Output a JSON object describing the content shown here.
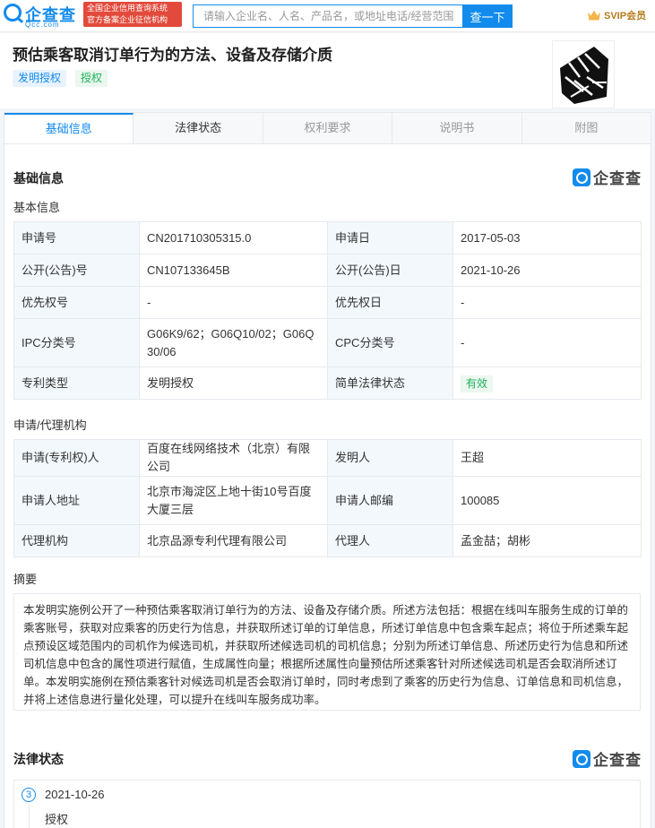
{
  "header": {
    "logo_name": "企查查",
    "logo_domain": "Qcc.com",
    "slogan_line1": "全国企业信用查询系统",
    "slogan_line2": "官方备案企业征信机构",
    "search_placeholder": "请输入企业名、人名、产品名，或地址电话/经营范围",
    "search_button": "查一下",
    "svip_label": "SVIP会员"
  },
  "patent": {
    "title": "预估乘客取消订单行为的方法、设备及存储介质",
    "tags": [
      "发明授权",
      "授权"
    ]
  },
  "tabs": [
    {
      "label": "基础信息",
      "state": "active"
    },
    {
      "label": "法律状态",
      "state": "normal"
    },
    {
      "label": "权利要求",
      "state": "muted"
    },
    {
      "label": "说明书",
      "state": "muted"
    },
    {
      "label": "附图",
      "state": "muted"
    }
  ],
  "basic": {
    "section_title": "基础信息",
    "watermark": "企查查",
    "subsection": "基本信息",
    "rows": [
      {
        "l1": "申请号",
        "v1": "CN201710305315.0",
        "l2": "申请日",
        "v2": "2017-05-03"
      },
      {
        "l1": "公开(公告)号",
        "v1": "CN107133645B",
        "l2": "公开(公告)日",
        "v2": "2021-10-26"
      },
      {
        "l1": "优先权号",
        "v1": "-",
        "l2": "优先权日",
        "v2": "-"
      },
      {
        "l1": "IPC分类号",
        "v1": "G06K9/62；G06Q10/02；G06Q30/06",
        "l2": "CPC分类号",
        "v2": "-"
      },
      {
        "l1": "专利类型",
        "v1": "发明授权",
        "l2": "简单法律状态",
        "v2": "有效"
      }
    ]
  },
  "applicant": {
    "subsection": "申请/代理机构",
    "rows": [
      {
        "l1": "申请(专利权)人",
        "v1": "百度在线网络技术（北京）有限公司",
        "l2": "发明人",
        "v2": "王超"
      },
      {
        "l1": "申请人地址",
        "v1": "北京市海淀区上地十街10号百度大厦三层",
        "l2": "申请人邮编",
        "v2": "100085"
      },
      {
        "l1": "代理机构",
        "v1": "北京品源专利代理有限公司",
        "l2": "代理人",
        "v2": "孟金喆；胡彬"
      }
    ]
  },
  "abstract": {
    "subsection": "摘要",
    "text": "本发明实施例公开了一种预估乘客取消订单行为的方法、设备及存储介质。所述方法包括：根据在线叫车服务生成的订单的乘客账号，获取对应乘客的历史行为信息，并获取所述订单的订单信息，所述订单信息中包含乘车起点；将位于所述乘车起点预设区域范围内的司机作为候选司机，并获取所述候选司机的司机信息；分别为所述订单信息、所述历史行为信息和所述司机信息中包含的属性项进行赋值，生成属性向量；根据所述属性向量预估所述乘客针对所述候选司机是否会取消所述订单。本发明实施例在预估乘客针对候选司机是否会取消订单时，同时考虑到了乘客的历史行为信息、订单信息和司机信息，并将上述信息进行量化处理，可以提升在线叫车服务成功率。"
  },
  "legal": {
    "section_title": "法律状态",
    "watermark": "企查查",
    "events": [
      {
        "num": "3",
        "date": "2021-10-26",
        "event": "授权"
      }
    ]
  }
}
